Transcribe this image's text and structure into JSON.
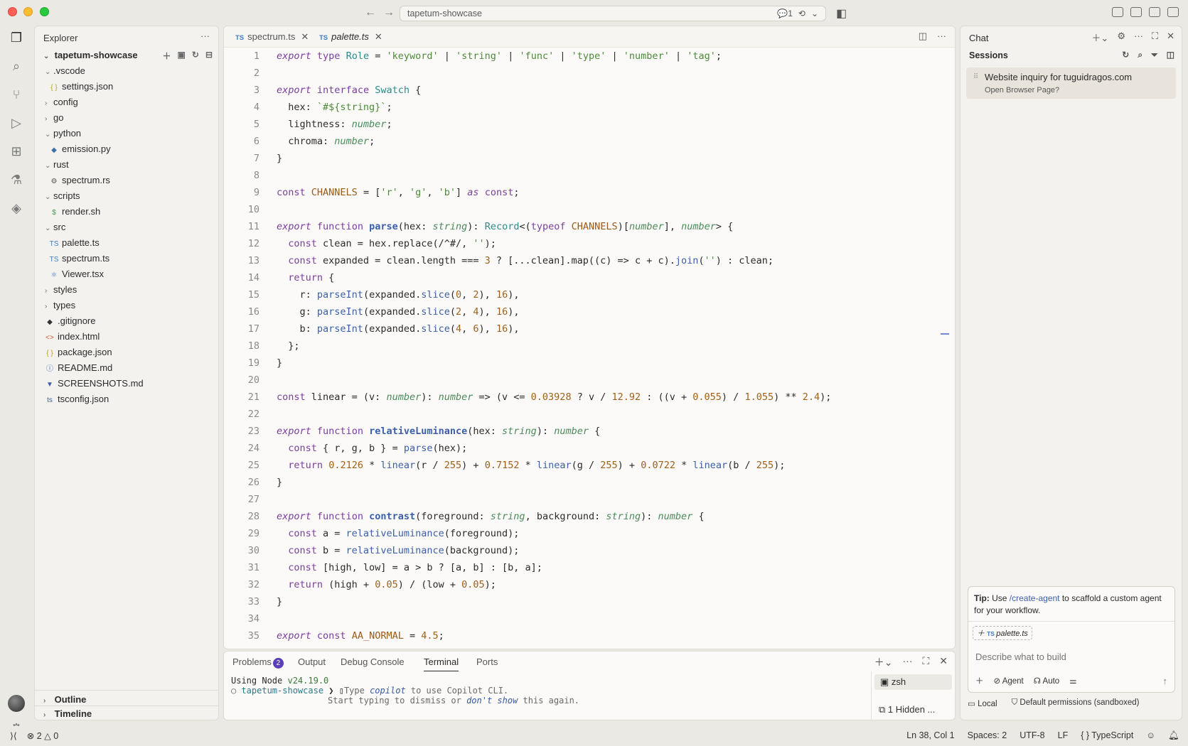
{
  "titlebar": {
    "search": "tapetum-showcase",
    "comments_count": "1"
  },
  "sidebar": {
    "title": "Explorer",
    "root": "tapetum-showcase",
    "tree": [
      {
        "label": ".vscode",
        "depth": 1,
        "type": "folder-open"
      },
      {
        "label": "settings.json",
        "depth": 2,
        "type": "json"
      },
      {
        "label": "config",
        "depth": 1,
        "type": "folder"
      },
      {
        "label": "go",
        "depth": 1,
        "type": "folder"
      },
      {
        "label": "python",
        "depth": 1,
        "type": "folder-open"
      },
      {
        "label": "emission.py",
        "depth": 2,
        "type": "py"
      },
      {
        "label": "rust",
        "depth": 1,
        "type": "folder-open"
      },
      {
        "label": "spectrum.rs",
        "depth": 2,
        "type": "rs"
      },
      {
        "label": "scripts",
        "depth": 1,
        "type": "folder-open"
      },
      {
        "label": "render.sh",
        "depth": 2,
        "type": "sh"
      },
      {
        "label": "src",
        "depth": 1,
        "type": "folder-open"
      },
      {
        "label": "palette.ts",
        "depth": 2,
        "type": "ts"
      },
      {
        "label": "spectrum.ts",
        "depth": 2,
        "type": "ts"
      },
      {
        "label": "Viewer.tsx",
        "depth": 2,
        "type": "tsx"
      },
      {
        "label": "styles",
        "depth": 1,
        "type": "folder"
      },
      {
        "label": "types",
        "depth": 1,
        "type": "folder"
      },
      {
        "label": ".gitignore",
        "depth": 1,
        "type": "git"
      },
      {
        "label": "index.html",
        "depth": 1,
        "type": "html"
      },
      {
        "label": "package.json",
        "depth": 1,
        "type": "json"
      },
      {
        "label": "README.md",
        "depth": 1,
        "type": "info"
      },
      {
        "label": "SCREENSHOTS.md",
        "depth": 1,
        "type": "md"
      },
      {
        "label": "tsconfig.json",
        "depth": 1,
        "type": "tsconfig"
      }
    ],
    "outline": "Outline",
    "timeline": "Timeline"
  },
  "editor": {
    "tabs": [
      {
        "label": "spectrum.ts",
        "active": false
      },
      {
        "label": "palette.ts",
        "active": true
      }
    ],
    "code_lines": [
      "export type Role = 'keyword' | 'string' | 'func' | 'type' | 'number' | 'tag';",
      "",
      "export interface Swatch {",
      "  hex: `#${string}`;",
      "  lightness: number;",
      "  chroma: number;",
      "}",
      "",
      "const CHANNELS = ['r', 'g', 'b'] as const;",
      "",
      "export function parse(hex: string): Record<(typeof CHANNELS)[number], number> {",
      "  const clean = hex.replace(/^#/, '');",
      "  const expanded = clean.length === 3 ? [...clean].map((c) => c + c).join('') : clean;",
      "  return {",
      "    r: parseInt(expanded.slice(0, 2), 16),",
      "    g: parseInt(expanded.slice(2, 4), 16),",
      "    b: parseInt(expanded.slice(4, 6), 16),",
      "  };",
      "}",
      "",
      "const linear = (v: number): number => (v <= 0.03928 ? v / 12.92 : ((v + 0.055) / 1.055) ** 2.4);",
      "",
      "export function relativeLuminance(hex: string): number {",
      "  const { r, g, b } = parse(hex);",
      "  return 0.2126 * linear(r / 255) + 0.7152 * linear(g / 255) + 0.0722 * linear(b / 255);",
      "}",
      "",
      "export function contrast(foreground: string, background: string): number {",
      "  const a = relativeLuminance(foreground);",
      "  const b = relativeLuminance(background);",
      "  const [high, low] = a > b ? [a, b] : [b, a];",
      "  return (high + 0.05) / (low + 0.05);",
      "}",
      "",
      "export const AA_NORMAL = 4.5;"
    ]
  },
  "panel": {
    "tabs": [
      "Problems",
      "Output",
      "Debug Console",
      "Terminal",
      "Ports"
    ],
    "problems_count": "2",
    "terminal": {
      "line1_prefix": "Using Node ",
      "line1_version": "v24.19.0",
      "prompt": "tapetum-showcase",
      "line2_a": "Type ",
      "line2_b": "copilot",
      "line2_c": " to use Copilot CLI.",
      "line3_a": "Start typing to dismiss or ",
      "line3_b": "don't show",
      "line3_c": " this again."
    },
    "terminal_list": {
      "zsh": "zsh",
      "hidden": "1 Hidden ..."
    }
  },
  "chat": {
    "title": "Chat",
    "sessions_label": "Sessions",
    "session": {
      "title": "Website inquiry for tuguidragos.com",
      "subtitle": "Open Browser Page?"
    },
    "tip_bold": "Tip:",
    "tip_pre": " Use ",
    "tip_link": "/create-agent",
    "tip_post": " to scaffold a custom agent for your workflow.",
    "context_file": "palette.ts",
    "input_placeholder": "Describe what to build",
    "agent_label": "Agent",
    "auto_label": "Auto",
    "footer_local": "Local",
    "footer_permissions": "Default permissions (sandboxed)"
  },
  "statusbar": {
    "errors": "2",
    "warnings": "0",
    "position": "Ln 38, Col 1",
    "spaces": "Spaces: 2",
    "encoding": "UTF-8",
    "eol": "LF",
    "language": "TypeScript"
  }
}
